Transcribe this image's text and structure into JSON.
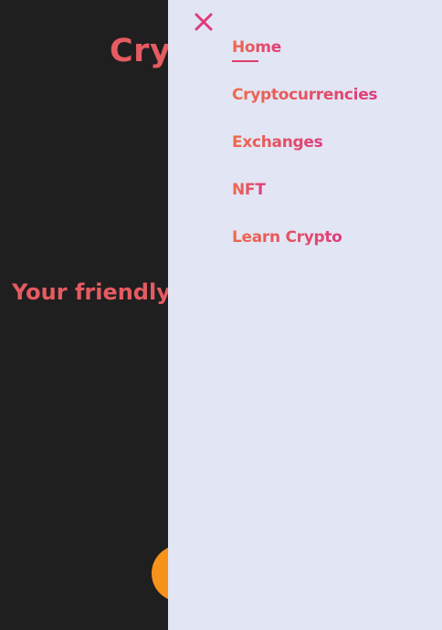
{
  "hero": {
    "title": "Crypto",
    "tagline": "Your friendly"
  },
  "drawer": {
    "close_icon": "close-icon",
    "items": [
      {
        "label": "Home",
        "active": true
      },
      {
        "label": "Cryptocurrencies",
        "active": false
      },
      {
        "label": "Exchanges",
        "active": false
      },
      {
        "label": "NFT",
        "active": false
      },
      {
        "label": "Learn Crypto",
        "active": false
      }
    ]
  },
  "colors": {
    "background": "#1f1f1f",
    "drawer_background": "#e2e5f3",
    "accent_start": "#ef6a4c",
    "accent_end": "#de3b7a",
    "coin": "#f7931a"
  }
}
